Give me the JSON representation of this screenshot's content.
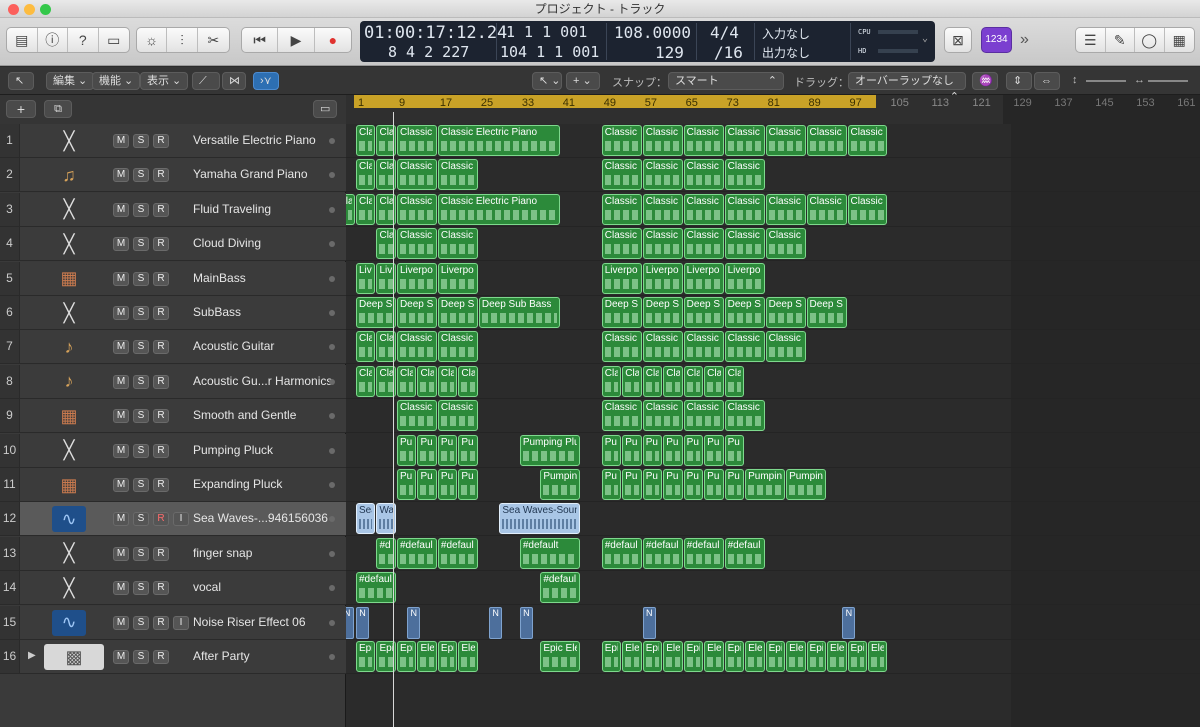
{
  "window_title": "プロジェクト - トラック",
  "lcd": {
    "time": "01:00:17:12.24",
    "bar_top": "1  1  1  001",
    "bar_bottom": "8  4  2  227",
    "bar2_bottom": "104  1  1  001",
    "tempo": "108.0000",
    "tempo_sub": "129",
    "sig": "4/4",
    "division": "/16",
    "in_label": "入力なし",
    "out_label": "出力なし",
    "cpu": "CPU",
    "hd": "HD"
  },
  "toolbar": {
    "count_in": "1234",
    "forward": "»"
  },
  "ctrl": {
    "edit": "編集",
    "function": "機能",
    "view": "表示",
    "snap_label": "スナップ：",
    "snap_value": "スマート",
    "drag_label": "ドラッグ：",
    "drag_value": "オーバーラップなし"
  },
  "ruler": {
    "ticks": [
      "1",
      "9",
      "17",
      "25",
      "33",
      "41",
      "49",
      "57",
      "65",
      "73",
      "81",
      "89",
      "97",
      "105",
      "113",
      "121",
      "129",
      "137",
      "145",
      "153",
      "161"
    ]
  },
  "msr": {
    "m": "M",
    "s": "S",
    "r": "R",
    "i": "I"
  },
  "tracks": [
    {
      "num": "1",
      "name": "Versatile Electric Piano",
      "icon": "keyboard-stand-icon"
    },
    {
      "num": "2",
      "name": "Yamaha Grand Piano",
      "icon": "grand-piano-icon"
    },
    {
      "num": "3",
      "name": "Fluid Traveling",
      "icon": "keyboard-stand-icon"
    },
    {
      "num": "4",
      "name": "Cloud Diving",
      "icon": "keyboard-stand-icon"
    },
    {
      "num": "5",
      "name": "MainBass",
      "icon": "synth-keyboard-icon"
    },
    {
      "num": "6",
      "name": "SubBass",
      "icon": "keyboard-stand-icon"
    },
    {
      "num": "7",
      "name": "Acoustic Guitar",
      "icon": "acoustic-guitar-icon"
    },
    {
      "num": "8",
      "name": "Acoustic Gu...r Harmonics",
      "icon": "acoustic-guitar-icon"
    },
    {
      "num": "9",
      "name": "Smooth and Gentle",
      "icon": "synth-keyboard-icon"
    },
    {
      "num": "10",
      "name": "Pumping Pluck",
      "icon": "keyboard-stand-icon"
    },
    {
      "num": "11",
      "name": "Expanding Pluck",
      "icon": "synth-keyboard-icon"
    },
    {
      "num": "12",
      "name": "Sea Waves-...946156036",
      "icon": "audio-waveform-icon"
    },
    {
      "num": "13",
      "name": "finger snap",
      "icon": "keyboard-stand-icon"
    },
    {
      "num": "14",
      "name": "vocal",
      "icon": "keyboard-stand-icon"
    },
    {
      "num": "15",
      "name": "Noise Riser Effect 06",
      "icon": "audio-waveform-icon"
    },
    {
      "num": "16",
      "name": "After Party",
      "icon": "drum-machine-icon"
    }
  ],
  "regions": [
    {
      "lane": 0,
      "bars": [
        [
          1,
          5,
          "Cla"
        ],
        [
          5,
          9,
          "Cla"
        ],
        [
          9,
          17,
          "Classic"
        ],
        [
          17,
          41,
          "Classic Electric Piano"
        ],
        [
          49,
          57,
          "Classic"
        ],
        [
          57,
          65,
          "Classic"
        ],
        [
          65,
          73,
          "Classic"
        ],
        [
          73,
          81,
          "Classic"
        ],
        [
          81,
          89,
          "Classic"
        ],
        [
          89,
          97,
          "Classic"
        ],
        [
          97,
          105,
          "Classic"
        ]
      ]
    },
    {
      "lane": 1,
      "bars": [
        [
          1,
          5,
          "Cla"
        ],
        [
          5,
          9,
          "Cla"
        ],
        [
          9,
          17,
          "Classic"
        ],
        [
          17,
          25,
          "Classic"
        ],
        [
          49,
          57,
          "Classic"
        ],
        [
          57,
          65,
          "Classic"
        ],
        [
          65,
          73,
          "Classic"
        ],
        [
          73,
          81,
          "Classic"
        ]
      ]
    },
    {
      "lane": 2,
      "bars": [
        [
          -3,
          1,
          "Cla"
        ],
        [
          1,
          5,
          "Cla"
        ],
        [
          5,
          9,
          "Cla"
        ],
        [
          9,
          17,
          "Classic"
        ],
        [
          17,
          41,
          "Classic Electric Piano"
        ],
        [
          49,
          57,
          "Classic"
        ],
        [
          57,
          65,
          "Classic"
        ],
        [
          65,
          73,
          "Classic"
        ],
        [
          73,
          81,
          "Classic"
        ],
        [
          81,
          89,
          "Classic"
        ],
        [
          89,
          97,
          "Classic"
        ],
        [
          97,
          105,
          "Classic"
        ]
      ]
    },
    {
      "lane": 3,
      "bars": [
        [
          5,
          9,
          "Cla"
        ],
        [
          9,
          17,
          "Classic"
        ],
        [
          17,
          25,
          "Classic"
        ],
        [
          49,
          57,
          "Classic"
        ],
        [
          57,
          65,
          "Classic"
        ],
        [
          65,
          73,
          "Classic"
        ],
        [
          73,
          81,
          "Classic"
        ],
        [
          81,
          89,
          "Classic"
        ]
      ]
    },
    {
      "lane": 4,
      "bars": [
        [
          1,
          5,
          "Liv"
        ],
        [
          5,
          9,
          "Liv"
        ],
        [
          9,
          17,
          "Liverpo"
        ],
        [
          17,
          25,
          "Liverpo"
        ],
        [
          49,
          57,
          "Liverpo"
        ],
        [
          57,
          65,
          "Liverpo"
        ],
        [
          65,
          73,
          "Liverpo"
        ],
        [
          73,
          81,
          "Liverpo"
        ]
      ]
    },
    {
      "lane": 5,
      "bars": [
        [
          1,
          9,
          "Deep S"
        ],
        [
          9,
          17,
          "Deep S"
        ],
        [
          17,
          25,
          "Deep S"
        ],
        [
          25,
          41,
          "Deep Sub Bass"
        ],
        [
          49,
          57,
          "Deep S"
        ],
        [
          57,
          65,
          "Deep S"
        ],
        [
          65,
          73,
          "Deep S"
        ],
        [
          73,
          81,
          "Deep S"
        ],
        [
          81,
          89,
          "Deep S"
        ],
        [
          89,
          97,
          "Deep S"
        ]
      ]
    },
    {
      "lane": 6,
      "bars": [
        [
          1,
          5,
          "Cla"
        ],
        [
          5,
          9,
          "Cla"
        ],
        [
          9,
          17,
          "Classic"
        ],
        [
          17,
          25,
          "Classic"
        ],
        [
          49,
          57,
          "Classic"
        ],
        [
          57,
          65,
          "Classic"
        ],
        [
          65,
          73,
          "Classic"
        ],
        [
          73,
          81,
          "Classic"
        ],
        [
          81,
          89,
          "Classic"
        ]
      ]
    },
    {
      "lane": 7,
      "bars": [
        [
          1,
          5,
          "Cla"
        ],
        [
          5,
          9,
          "Cla"
        ],
        [
          9,
          13,
          "Cla"
        ],
        [
          13,
          17,
          "Cla"
        ],
        [
          17,
          21,
          "Cla"
        ],
        [
          21,
          25,
          "Cla"
        ],
        [
          49,
          53,
          "Cla"
        ],
        [
          53,
          57,
          "Cla"
        ],
        [
          57,
          61,
          "Cla"
        ],
        [
          61,
          65,
          "Cla"
        ],
        [
          65,
          69,
          "Cla"
        ],
        [
          69,
          73,
          "Cla"
        ],
        [
          73,
          77,
          "Cla"
        ]
      ]
    },
    {
      "lane": 8,
      "bars": [
        [
          9,
          17,
          "Classic"
        ],
        [
          17,
          25,
          "Classic"
        ],
        [
          49,
          57,
          "Classic"
        ],
        [
          57,
          65,
          "Classic"
        ],
        [
          65,
          73,
          "Classic"
        ],
        [
          73,
          81,
          "Classic"
        ]
      ]
    },
    {
      "lane": 9,
      "bars": [
        [
          9,
          13,
          "Pu"
        ],
        [
          13,
          17,
          "Pu"
        ],
        [
          17,
          21,
          "Pu"
        ],
        [
          21,
          25,
          "Pu"
        ],
        [
          33,
          45,
          "Pumping Plu"
        ],
        [
          49,
          53,
          "Pu"
        ],
        [
          53,
          57,
          "Pu"
        ],
        [
          57,
          61,
          "Pu"
        ],
        [
          61,
          65,
          "Pu"
        ],
        [
          65,
          69,
          "Pu"
        ],
        [
          69,
          73,
          "Pu"
        ],
        [
          73,
          77,
          "Pu"
        ]
      ]
    },
    {
      "lane": 10,
      "bars": [
        [
          9,
          13,
          "Pu"
        ],
        [
          13,
          17,
          "Pu"
        ],
        [
          17,
          21,
          "Pu"
        ],
        [
          21,
          25,
          "Pu"
        ],
        [
          37,
          45,
          "Pumpin"
        ],
        [
          49,
          53,
          "Pu"
        ],
        [
          53,
          57,
          "Pu"
        ],
        [
          57,
          61,
          "Pu"
        ],
        [
          61,
          65,
          "Pu"
        ],
        [
          65,
          69,
          "Pu"
        ],
        [
          69,
          73,
          "Pu"
        ],
        [
          73,
          77,
          "Pu"
        ],
        [
          77,
          85,
          "Pumpin"
        ],
        [
          85,
          93,
          "Pumpin"
        ]
      ]
    },
    {
      "lane": 11,
      "audio": true,
      "bars": [
        [
          1,
          5,
          "Sea"
        ],
        [
          5,
          9,
          "Wa"
        ],
        [
          29,
          45,
          "Sea Waves-Soun"
        ]
      ]
    },
    {
      "lane": 12,
      "bars": [
        [
          5,
          9,
          "#d"
        ],
        [
          9,
          17,
          "#defaul"
        ],
        [
          17,
          25,
          "#defaul"
        ],
        [
          33,
          45,
          "#default"
        ],
        [
          49,
          57,
          "#defaul"
        ],
        [
          57,
          65,
          "#defaul"
        ],
        [
          65,
          73,
          "#defaul"
        ],
        [
          73,
          81,
          "#defaul"
        ]
      ]
    },
    {
      "lane": 13,
      "bars": [
        [
          1,
          9,
          "#defaul"
        ],
        [
          37,
          45,
          "#defaul"
        ]
      ]
    },
    {
      "lane": 15,
      "bars": [
        [
          1,
          5,
          "Epi"
        ],
        [
          5,
          9,
          "Epi"
        ],
        [
          9,
          13,
          "Epic"
        ],
        [
          13,
          17,
          "Ele"
        ],
        [
          17,
          21,
          "Epic"
        ],
        [
          21,
          25,
          "Ele"
        ],
        [
          37,
          45,
          "Epic Ele"
        ],
        [
          49,
          53,
          "Epic"
        ],
        [
          53,
          57,
          "Ele"
        ],
        [
          57,
          61,
          "Epic"
        ],
        [
          61,
          65,
          "Ele"
        ],
        [
          65,
          69,
          "Epic"
        ],
        [
          69,
          73,
          "Ele"
        ],
        [
          73,
          77,
          "Epic"
        ],
        [
          77,
          81,
          "Ele"
        ],
        [
          81,
          85,
          "Epic"
        ],
        [
          85,
          89,
          "Ele"
        ],
        [
          89,
          93,
          "Epic"
        ],
        [
          93,
          97,
          "Ele"
        ],
        [
          97,
          101,
          "Epic"
        ],
        [
          101,
          105,
          "Ele"
        ]
      ]
    }
  ],
  "markers": {
    "lane": 14,
    "label": "N",
    "bars": [
      -2,
      1,
      11,
      27,
      33,
      57,
      96
    ]
  },
  "colors": {
    "region_green": "#2c8a3a",
    "cycle_yellow": "#c9a227",
    "record_red": "#e0322f",
    "accent_purple": "#7b3fd0"
  }
}
